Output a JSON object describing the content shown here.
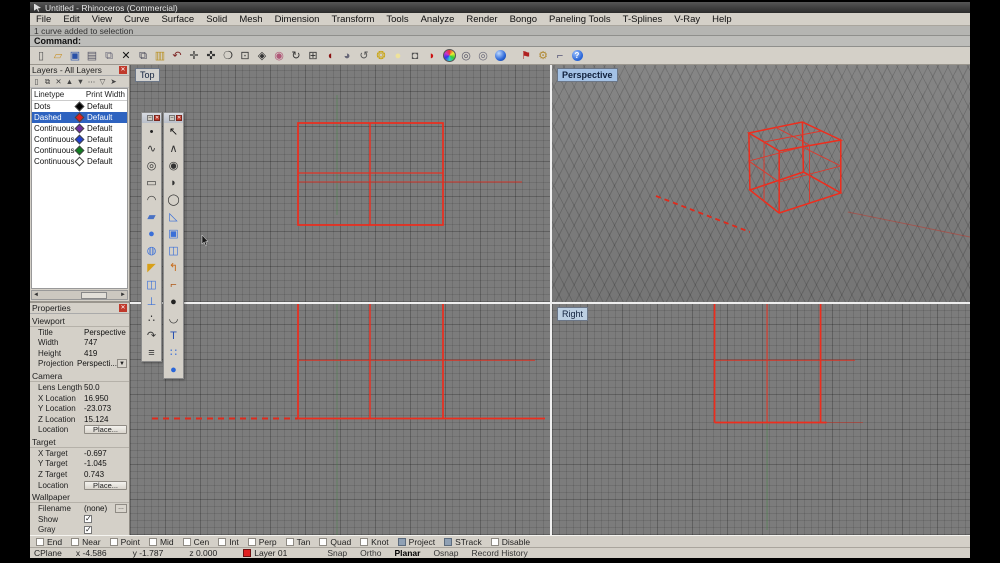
{
  "window": {
    "title": "Untitled - Rhinoceros (Commercial)"
  },
  "menu": {
    "items": [
      "File",
      "Edit",
      "View",
      "Curve",
      "Surface",
      "Solid",
      "Mesh",
      "Dimension",
      "Transform",
      "Tools",
      "Analyze",
      "Render",
      "Bongo",
      "Paneling Tools",
      "T-Splines",
      "V-Ray",
      "Help"
    ]
  },
  "command": {
    "history": "1 curve added to selection",
    "prompt": "Command:"
  },
  "main_toolbar": {
    "icons": [
      {
        "name": "new-file-icon",
        "glyph": "▯",
        "color": "#555",
        "cls": ""
      },
      {
        "name": "open-folder-icon",
        "glyph": "▱",
        "color": "#c8932b",
        "cls": ""
      },
      {
        "name": "save-icon",
        "glyph": "▣",
        "color": "#2850a8",
        "cls": ""
      },
      {
        "name": "print-icon",
        "glyph": "▤",
        "color": "#556",
        "cls": ""
      },
      {
        "name": "export-icon",
        "glyph": "⧉",
        "color": "#667",
        "cls": ""
      },
      {
        "name": "delete-icon",
        "glyph": "✕",
        "color": "#111",
        "cls": ""
      },
      {
        "name": "copy-icon",
        "glyph": "⧉",
        "color": "#445",
        "cls": ""
      },
      {
        "name": "paste-icon",
        "glyph": "▥",
        "color": "#b89020",
        "cls": ""
      },
      {
        "name": "undo-icon",
        "glyph": "↶",
        "color": "#7a1f1f",
        "cls": ""
      },
      {
        "name": "pan-icon",
        "glyph": "✛",
        "color": "#333",
        "cls": ""
      },
      {
        "name": "move-icon",
        "glyph": "✜",
        "color": "#333",
        "cls": ""
      },
      {
        "name": "zoom-icon",
        "glyph": "❍",
        "color": "#333",
        "cls": ""
      },
      {
        "name": "zoom-window-icon",
        "glyph": "⊡",
        "color": "#333",
        "cls": ""
      },
      {
        "name": "zoom-dynamic-icon",
        "glyph": "◈",
        "color": "#333",
        "cls": ""
      },
      {
        "name": "zoom-selected-icon",
        "glyph": "◉",
        "color": "#b05878",
        "cls": ""
      },
      {
        "name": "rotate-view-icon",
        "glyph": "↻",
        "color": "#333",
        "cls": ""
      },
      {
        "name": "viewport-layout-icon",
        "glyph": "⊞",
        "color": "#333",
        "cls": ""
      },
      {
        "name": "shaded-view-icon",
        "glyph": "◖",
        "color": "#8a1010",
        "cls": ""
      },
      {
        "name": "render-preview-icon",
        "glyph": "◕",
        "color": "#667",
        "cls": ""
      },
      {
        "name": "refresh-view-icon",
        "glyph": "↺",
        "color": "#555",
        "cls": ""
      },
      {
        "name": "spotlight-icon",
        "glyph": "❂",
        "color": "#c8a000",
        "cls": ""
      },
      {
        "name": "lightbulb-icon",
        "glyph": "●",
        "color": "#eee29a",
        "cls": ""
      },
      {
        "name": "lock-icon",
        "glyph": "◘",
        "color": "#555",
        "cls": ""
      },
      {
        "name": "render-icon",
        "glyph": "◗",
        "color": "#cc1111",
        "cls": ""
      },
      {
        "name": "color-wheel-icon",
        "glyph": "",
        "color": "",
        "cls": "i-colorwheel"
      },
      {
        "name": "environment-icon",
        "glyph": "◎",
        "color": "#556",
        "cls": ""
      },
      {
        "name": "ground-plane-icon",
        "glyph": "◎",
        "color": "#667",
        "cls": ""
      },
      {
        "name": "render-sphere-icon",
        "glyph": "",
        "color": "",
        "cls": "i-ball"
      },
      {
        "name": "flag-icon",
        "glyph": "⚑",
        "color": "#b02020",
        "cls": "gap-left"
      },
      {
        "name": "options-gears-icon",
        "glyph": "⚙",
        "color": "#b08830",
        "cls": ""
      },
      {
        "name": "linked-blocks-icon",
        "glyph": "⌐",
        "color": "#557",
        "cls": ""
      },
      {
        "name": "help-icon",
        "glyph": "",
        "color": "",
        "cls": "i-help"
      }
    ]
  },
  "layers_panel": {
    "title": "Layers - All Layers",
    "close_glyph": "✕",
    "toolbar": [
      {
        "name": "new-layer-icon",
        "glyph": "▯"
      },
      {
        "name": "copy-layer-icon",
        "glyph": "⧉"
      },
      {
        "name": "delete-layer-icon",
        "glyph": "✕"
      },
      {
        "name": "move-up-icon",
        "glyph": "▲"
      },
      {
        "name": "move-down-icon",
        "glyph": "▼"
      },
      {
        "name": "expand-icon",
        "glyph": "⋯"
      },
      {
        "name": "filter-icon",
        "glyph": "▽"
      },
      {
        "name": "layer-tools-icon",
        "glyph": "➤"
      }
    ],
    "columns": {
      "linetype": "Linetype",
      "print_width": "Print Width"
    },
    "rows": [
      {
        "linetype": "Dots",
        "print_width": "Default",
        "swatch": "#000000",
        "row_cls": ""
      },
      {
        "linetype": "Dashed",
        "print_width": "Default",
        "swatch": "#e02020",
        "row_cls": "selected"
      },
      {
        "linetype": "Continuous",
        "print_width": "Default",
        "swatch": "#7030a0",
        "row_cls": ""
      },
      {
        "linetype": "Continuous",
        "print_width": "Default",
        "swatch": "#2040d0",
        "row_cls": ""
      },
      {
        "linetype": "Continuous",
        "print_width": "Default",
        "swatch": "#108020",
        "row_cls": ""
      },
      {
        "linetype": "Continuous",
        "print_width": "Default",
        "swatch": "#ffffff",
        "row_cls": ""
      }
    ]
  },
  "props": {
    "title": "Properties",
    "close_glyph": "✕",
    "viewport_heading": "Viewport",
    "title_label": "Title",
    "title_value": "Perspective",
    "width_label": "Width",
    "width_value": "747",
    "height_label": "Height",
    "height_value": "419",
    "projection_label": "Projection",
    "projection_value": "Perspecti...",
    "camera_heading": "Camera",
    "lens_label": "Lens Length",
    "lens_value": "50.0",
    "xloc_label": "X Location",
    "xloc_value": "16.950",
    "yloc_label": "Y Location",
    "yloc_value": "-23.073",
    "zloc_label": "Z Location",
    "zloc_value": "15.124",
    "cam_location_label": "Location",
    "cam_place_button": "Place...",
    "target_heading": "Target",
    "xtarget_label": "X Target",
    "xtarget_value": "-0.697",
    "ytarget_label": "Y Target",
    "ytarget_value": "-1.045",
    "ztarget_label": "Z Target",
    "ztarget_value": "0.743",
    "target_location_label": "Location",
    "target_place_button": "Place...",
    "wallpaper_heading": "Wallpaper",
    "filename_label": "Filename",
    "filename_value": "(none)",
    "show_label": "Show",
    "gray_label": "Gray"
  },
  "viewports": {
    "top": "Top",
    "perspective": "Perspective",
    "right": "Right"
  },
  "float_toolbar_a": {
    "icons": [
      {
        "name": "point-icon",
        "glyph": "•",
        "color": "#222"
      },
      {
        "name": "control-point-curve-icon",
        "glyph": "∿",
        "color": "#333"
      },
      {
        "name": "circle-icon",
        "glyph": "◎",
        "color": "#333"
      },
      {
        "name": "rectangle-icon",
        "glyph": "▭",
        "color": "#333"
      },
      {
        "name": "arc-icon",
        "glyph": "◠",
        "color": "#333"
      },
      {
        "name": "surface-icon",
        "glyph": "▰",
        "color": "#4a72c4"
      },
      {
        "name": "sphere-icon",
        "glyph": "●",
        "color": "#3a6fd8"
      },
      {
        "name": "ellipsoid-icon",
        "glyph": "◍",
        "color": "#3a6fd8"
      },
      {
        "name": "extrude-icon",
        "glyph": "◤",
        "color": "#d8a018"
      },
      {
        "name": "solid-union-icon",
        "glyph": "◫",
        "color": "#3a6fd8"
      },
      {
        "name": "pipe-icon",
        "glyph": "⊥",
        "color": "#3a6fd8"
      },
      {
        "name": "point-cloud-icon",
        "glyph": "∴",
        "color": "#333"
      },
      {
        "name": "handle-curve-icon",
        "glyph": "↷",
        "color": "#333"
      },
      {
        "name": "hatch-icon",
        "glyph": "≡",
        "color": "#333"
      }
    ]
  },
  "float_toolbar_b": {
    "icons": [
      {
        "name": "pointer-icon",
        "glyph": "↖",
        "color": "#111"
      },
      {
        "name": "polyline-icon",
        "glyph": "∧",
        "color": "#333"
      },
      {
        "name": "circle-center-icon",
        "glyph": "◉",
        "color": "#333"
      },
      {
        "name": "arc-3pt-icon",
        "glyph": "◗",
        "color": "#333"
      },
      {
        "name": "ellipse-icon",
        "glyph": "◯",
        "color": "#333"
      },
      {
        "name": "surface-corner-icon",
        "glyph": "◺",
        "color": "#3a6fd8"
      },
      {
        "name": "box-icon",
        "glyph": "▣",
        "color": "#3a6fd8"
      },
      {
        "name": "cylinder-icon",
        "glyph": "◫",
        "color": "#3a6fd8"
      },
      {
        "name": "deform-icon",
        "glyph": "↰",
        "color": "#c86a18"
      },
      {
        "name": "elbow-pipe-icon",
        "glyph": "⌐",
        "color": "#b05818"
      },
      {
        "name": "boolean-icon",
        "glyph": "●",
        "color": "#222"
      },
      {
        "name": "arc-icon",
        "glyph": "◡",
        "color": "#333"
      },
      {
        "name": "text-icon",
        "glyph": "T",
        "color": "#2850b0"
      },
      {
        "name": "array-icon",
        "glyph": "∷",
        "color": "#3a6fd8"
      },
      {
        "name": "render-sphere-icon",
        "glyph": "●",
        "color": "#2a66d8"
      }
    ]
  },
  "osnap": {
    "items": [
      {
        "label": "End",
        "cls": ""
      },
      {
        "label": "Near",
        "cls": ""
      },
      {
        "label": "Point",
        "cls": ""
      },
      {
        "label": "Mid",
        "cls": ""
      },
      {
        "label": "Cen",
        "cls": ""
      },
      {
        "label": "Int",
        "cls": ""
      },
      {
        "label": "Perp",
        "cls": ""
      },
      {
        "label": "Tan",
        "cls": ""
      },
      {
        "label": "Quad",
        "cls": ""
      },
      {
        "label": "Knot",
        "cls": ""
      },
      {
        "label": "Project",
        "cls": "filled"
      },
      {
        "label": "STrack",
        "cls": "filled"
      },
      {
        "label": "Disable",
        "cls": ""
      }
    ]
  },
  "statusbar": {
    "cplane": "CPlane",
    "x": "x -4.586",
    "y": "y -1.787",
    "z": "z 0.000",
    "layer": "Layer 01",
    "toggles": [
      {
        "label": "Snap",
        "cls": ""
      },
      {
        "label": "Ortho",
        "cls": ""
      },
      {
        "label": "Planar",
        "cls": "bold"
      },
      {
        "label": "Osnap",
        "cls": ""
      },
      {
        "label": "Record History",
        "cls": ""
      }
    ]
  }
}
